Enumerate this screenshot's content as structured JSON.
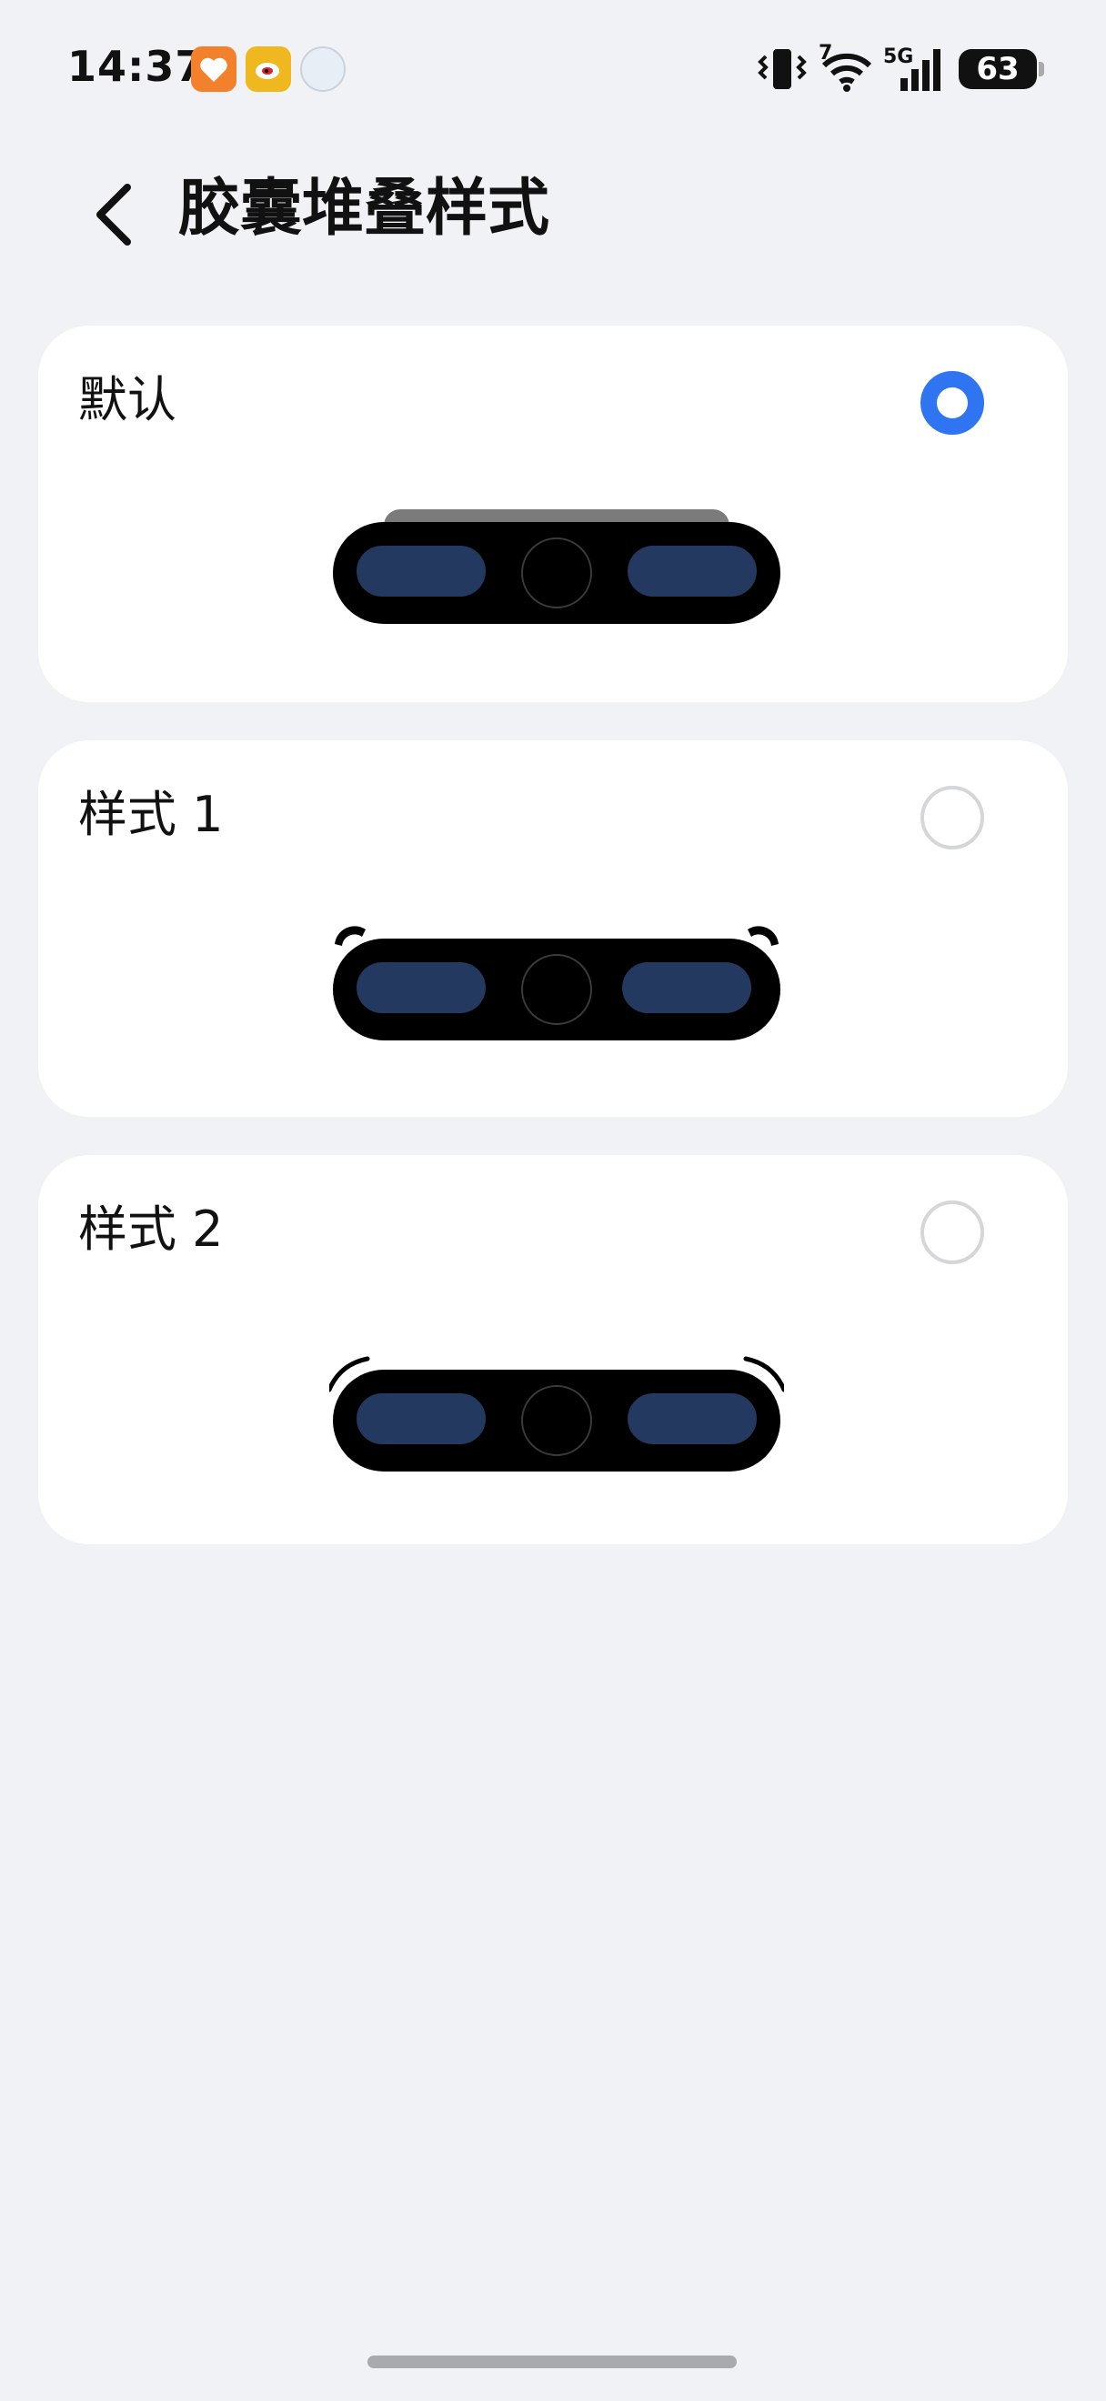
{
  "status_bar": {
    "time": "14:37",
    "wifi_badge": "7",
    "network": "5G",
    "battery": "63",
    "icons": [
      "health-app-icon",
      "weibo-app-icon",
      "pearl-app-icon",
      "vibrate-icon",
      "wifi-icon",
      "signal-icon",
      "battery-icon"
    ]
  },
  "header": {
    "title": "胶囊堆叠样式",
    "back_icon": "chevron-left-icon"
  },
  "options": [
    {
      "label": "默认",
      "selected": true
    },
    {
      "label": "样式 1",
      "selected": false
    },
    {
      "label": "样式 2",
      "selected": false
    }
  ],
  "colors": {
    "background": "#f1f2f6",
    "card": "#ffffff",
    "accent": "#2f74f0",
    "capsule": "#000000",
    "capsule_slot": "#23395f"
  }
}
